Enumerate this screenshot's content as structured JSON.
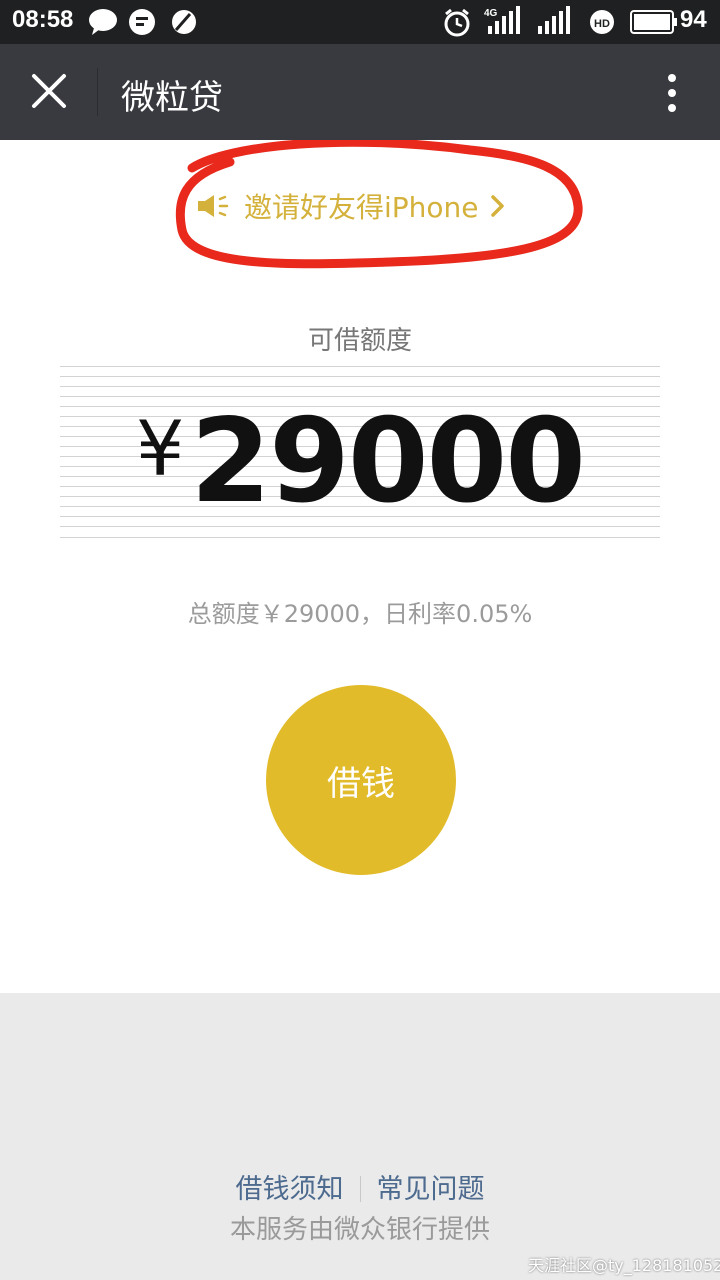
{
  "status_bar": {
    "time": "08:58",
    "network": "4G",
    "battery": "94",
    "icons": [
      "chat-bubble-icon",
      "message-icon",
      "app-icon",
      "alarm-icon",
      "signal-icon",
      "signal-icon",
      "hd-icon",
      "battery-icon"
    ]
  },
  "nav": {
    "title": "微粒贷",
    "close_icon": "close-icon",
    "more_icon": "more-vertical-icon"
  },
  "invite": {
    "text": "邀请好友得iPhone",
    "icon": "speaker-icon",
    "arrow_icon": "chevron-right-icon",
    "color": "#d4b13b"
  },
  "quota": {
    "label": "可借额度",
    "currency": "¥",
    "amount": "29000"
  },
  "total_info": "总额度￥29000，日利率0.05%",
  "borrow_button": {
    "label": "借钱",
    "color": "#e2bb2a"
  },
  "footer": {
    "link_notice": "借钱须知",
    "link_faq": "常见问题",
    "provider": "本服务由微众银行提供"
  },
  "watermark": "天涯社区@ty_128181052",
  "colors": {
    "status_bar_bg": "#1f2021",
    "nav_bg": "#393a3f",
    "footer_bg": "#eaeaea",
    "link": "#4d6a8f",
    "annotation": "#e8291c"
  }
}
